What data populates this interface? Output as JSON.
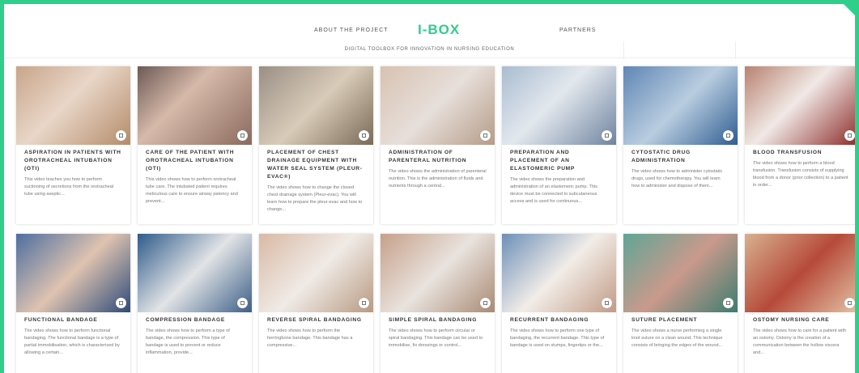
{
  "nav": {
    "about": "ABOUT THE PROJECT",
    "logo": "I-BOX",
    "partners": "PARTNERS"
  },
  "tagline": "DIGITAL TOOLBOX FOR INNOVATION IN NURSING EDUCATION",
  "colors": {
    "accent": "#2ecf8a"
  },
  "cards": [
    {
      "title": "Aspiration in patients with orotracheal intubation (OTI)",
      "desc": "This video teaches you how to perform suctioning of secretions from the orotracheal tube using aseptic...",
      "icon": "video-icon"
    },
    {
      "title": "Care of the patient with orotracheal intubation (OTI)",
      "desc": "This video shows how to perform orotracheal tube care. The intubated patient requires meticulous care to ensure airway patency and prevent...",
      "icon": "video-icon"
    },
    {
      "title": "Placement of chest drainage equipment with water seal system (Pleur-evac®)",
      "desc": "The video shows how to change the closed chest drainage system (Pleur-evac). You will learn how to prepare the pleur-evac and how to change...",
      "icon": "video-icon"
    },
    {
      "title": "Administration of parenteral nutrition",
      "desc": "The video shows the administration of parenteral nutrition. This is the administration of fluids and nutrients through a central...",
      "icon": "video-icon"
    },
    {
      "title": "Preparation and placement of an elastomeric pump",
      "desc": "The video shows the preparation and administration of an elastomeric pump. This device must be connected to subcutaneous access and is used for continuous...",
      "icon": "video-icon"
    },
    {
      "title": "Cytostatic drug administration",
      "desc": "The video shows how to administer cytostatic drugs, used for chemotherapy. You will learn how to administer and dispose of them...",
      "icon": "video-icon"
    },
    {
      "title": "Blood transfusion",
      "desc": "The video shows how to perform a blood transfusion. Transfusion consists of supplying blood from a donor (prior collection) to a patient in order...",
      "icon": "video-icon"
    },
    {
      "title": "Functional bandage",
      "desc": "The video shows how to perform functional bandaging. The functional bandage is a type of partial immobilisation, which is characterised by allowing a certain...",
      "icon": "video-icon"
    },
    {
      "title": "Compression bandage",
      "desc": "The video shows how to perform a type of bandage, the compression. This type of bandage is used to prevent or reduce inflammation, provide...",
      "icon": "video-icon"
    },
    {
      "title": "Reverse spiral bandaging",
      "desc": "The video shows how to perform the herringbone bandage. This bandage has a compressive...",
      "icon": "video-icon"
    },
    {
      "title": "Simple spiral bandaging",
      "desc": "The video shows how to perform circular or spiral bandaging. This bandage can be used to immobilise, fix dressings or control...",
      "icon": "video-icon"
    },
    {
      "title": "Recurrent bandaging",
      "desc": "The video shows how to perform one type of bandaging, the recurrent bandage. This type of bandage is used on stumps, fingertips or the...",
      "icon": "video-icon"
    },
    {
      "title": "Suture placement",
      "desc": "The video shows a nurse performing a single knot suture on a clean wound. This technique consists of bringing the edges of the wound...",
      "icon": "video-icon"
    },
    {
      "title": "Ostomy nursing care",
      "desc": "The video shows how to care for a patient with an ostomy. Ostomy is the creation of a communication between the hollow viscera and...",
      "icon": "video-icon"
    }
  ]
}
